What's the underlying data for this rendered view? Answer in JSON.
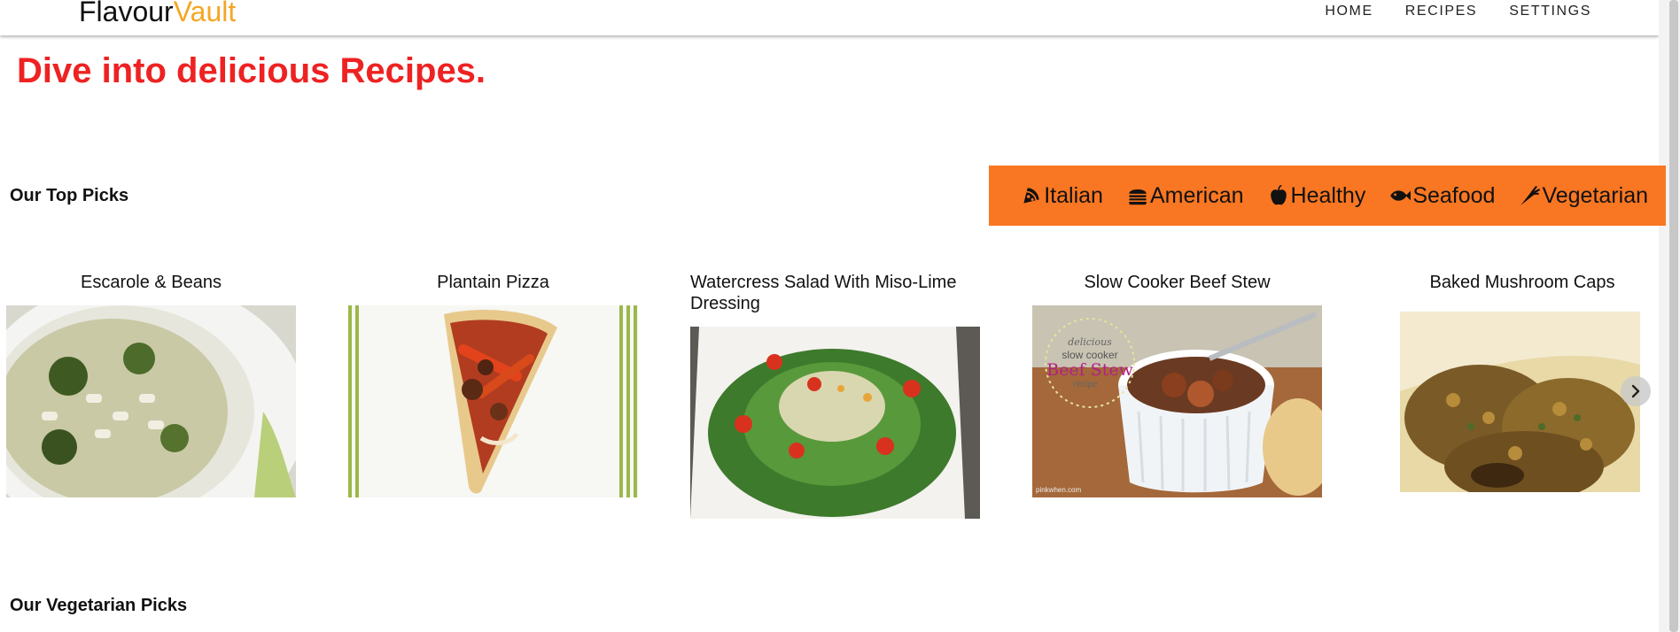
{
  "brand": {
    "part1": "Flavour",
    "part2": "Vault"
  },
  "nav": [
    "HOME",
    "RECIPES",
    "SETTINGS"
  ],
  "hero": "Dive into delicious Recipes.",
  "top_picks": {
    "title": "Our Top Picks",
    "cards": [
      {
        "title": "Escarole & Beans"
      },
      {
        "title": "Plantain Pizza"
      },
      {
        "title": "Watercress Salad With Miso-Lime Dressing"
      },
      {
        "title": "Slow Cooker Beef Stew",
        "image_text": {
          "top": "delicious",
          "middle": "slow cooker",
          "main": "Beef Stew",
          "sub": "recipe",
          "credit": "pinkwhen.com"
        }
      },
      {
        "title": "Baked Mushroom Caps"
      }
    ]
  },
  "cuisines": [
    {
      "label": "Italian",
      "icon": "pizza-icon"
    },
    {
      "label": "American",
      "icon": "burger-icon"
    },
    {
      "label": "Healthy",
      "icon": "apple-icon"
    },
    {
      "label": "Seafood",
      "icon": "fish-icon"
    },
    {
      "label": "Vegetarian",
      "icon": "carrot-icon"
    }
  ],
  "vegetarian_picks": {
    "title": "Our Vegetarian Picks"
  },
  "colors": {
    "accent": "#f97722",
    "hero": "#ee2222",
    "brand": "#f5a623"
  }
}
